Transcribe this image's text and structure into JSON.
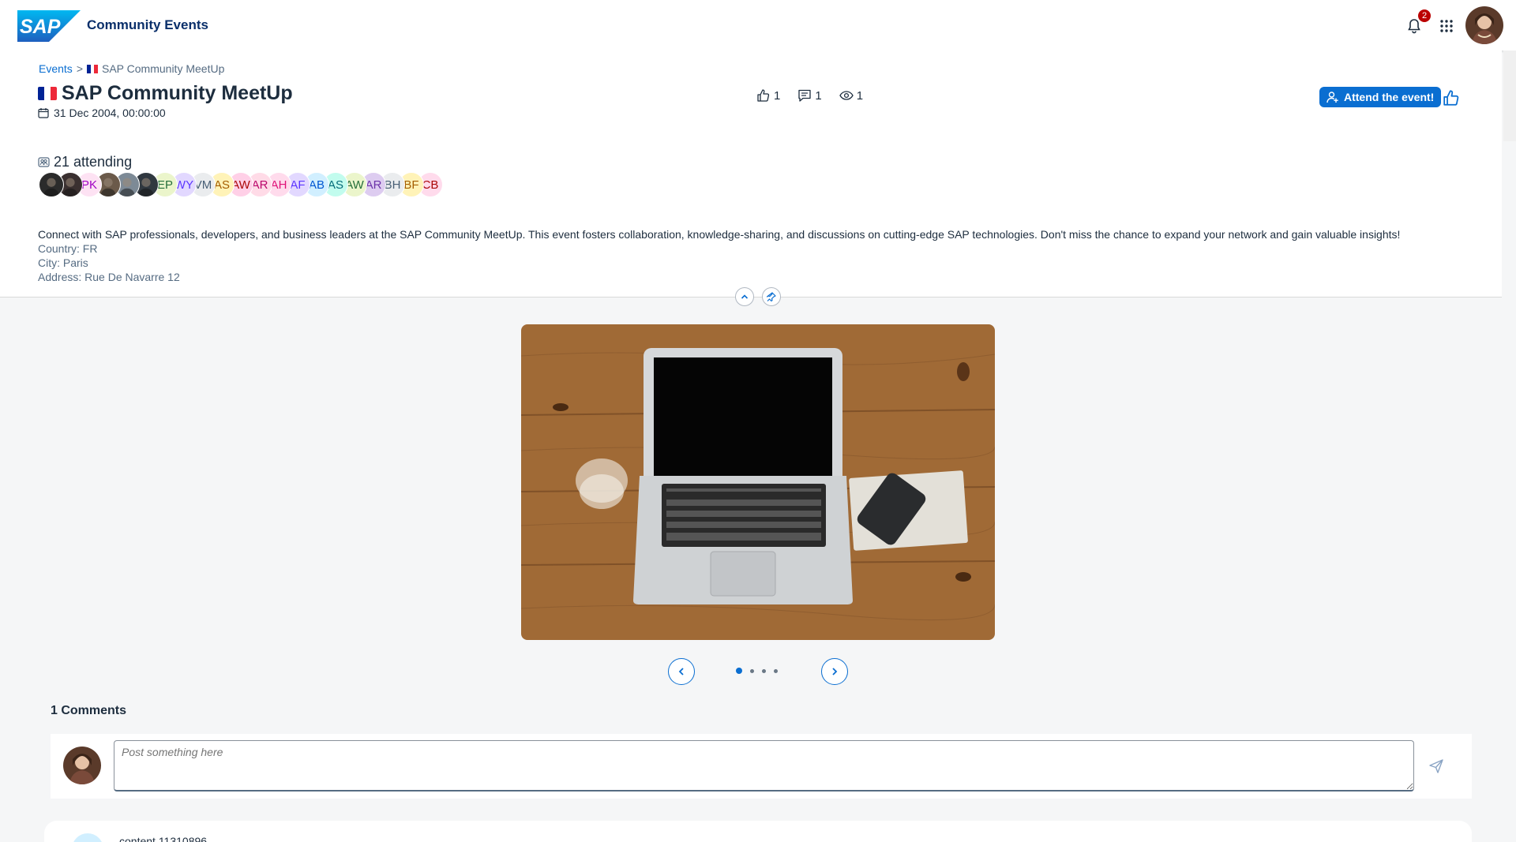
{
  "shell": {
    "logo_text": "SAP",
    "app_title": "Community Events",
    "notification_count": "2"
  },
  "breadcrumb": {
    "root": "Events",
    "separator": ">",
    "current": "SAP Community MeetUp"
  },
  "event": {
    "title": "SAP Community MeetUp",
    "date": "31 Dec 2004, 00:00:00",
    "likes": "1",
    "comments": "1",
    "views": "1",
    "attend_label": "Attend the event!",
    "attending_label": "21 attending",
    "description": "Connect with SAP professionals, developers, and business leaders at the SAP Community MeetUp. This event fosters collaboration, knowledge-sharing, and discussions on cutting-edge SAP technologies. Don't miss the chance to expand your network and gain valuable insights!",
    "country": "Country: FR",
    "city": "City: Paris",
    "address": "Address: Rue De Navarre 12"
  },
  "attendees": [
    {
      "type": "photo",
      "color": "#2b2b2b"
    },
    {
      "type": "photo",
      "color": "#3a3030"
    },
    {
      "type": "initials",
      "text": "PK",
      "bg": "#fde2f3",
      "fg": "#a100c2"
    },
    {
      "type": "photo",
      "color": "#6b5a4a"
    },
    {
      "type": "photo",
      "color": "#7d8a96"
    },
    {
      "type": "photo",
      "color": "#303840"
    },
    {
      "type": "initials",
      "text": "EP",
      "bg": "#ebf5cb",
      "fg": "#256f3a"
    },
    {
      "type": "initials",
      "text": "WY",
      "bg": "#e2d8ff",
      "fg": "#5d36ff"
    },
    {
      "type": "initials",
      "text": "VM",
      "bg": "#eaecee",
      "fg": "#475e75"
    },
    {
      "type": "initials",
      "text": "AS",
      "bg": "#fff3b8",
      "fg": "#a45d00"
    },
    {
      "type": "initials",
      "text": "AW",
      "bg": "#ffd0e7",
      "fg": "#aa0808"
    },
    {
      "type": "initials",
      "text": "AR",
      "bg": "#ffdbe7",
      "fg": "#ba066c"
    },
    {
      "type": "initials",
      "text": "AH",
      "bg": "#ffdbec",
      "fg": "#df1278"
    },
    {
      "type": "initials",
      "text": "AF",
      "bg": "#e2d8ff",
      "fg": "#5d36ff"
    },
    {
      "type": "initials",
      "text": "AB",
      "bg": "#d1efff",
      "fg": "#0057d2"
    },
    {
      "type": "initials",
      "text": "AS",
      "bg": "#c2fcee",
      "fg": "#046c7a"
    },
    {
      "type": "initials",
      "text": "AW",
      "bg": "#ebf5cb",
      "fg": "#256f3a"
    },
    {
      "type": "initials",
      "text": "AR",
      "bg": "#ddccf0",
      "fg": "#6c32a9"
    },
    {
      "type": "initials",
      "text": "BH",
      "bg": "#eaecee",
      "fg": "#475e75"
    },
    {
      "type": "initials",
      "text": "BF",
      "bg": "#fff3b8",
      "fg": "#a45d00"
    },
    {
      "type": "initials",
      "text": "CB",
      "bg": "#ffdbec",
      "fg": "#aa0808"
    }
  ],
  "carousel": {
    "slides": 4,
    "active": 1
  },
  "comments": {
    "title": "1 Comments",
    "placeholder": "Post something here",
    "first_text": "content 11310896"
  },
  "colors": {
    "accent": "#0a6ed1",
    "title": "#0a2f6a",
    "badge": "#bb0000"
  }
}
